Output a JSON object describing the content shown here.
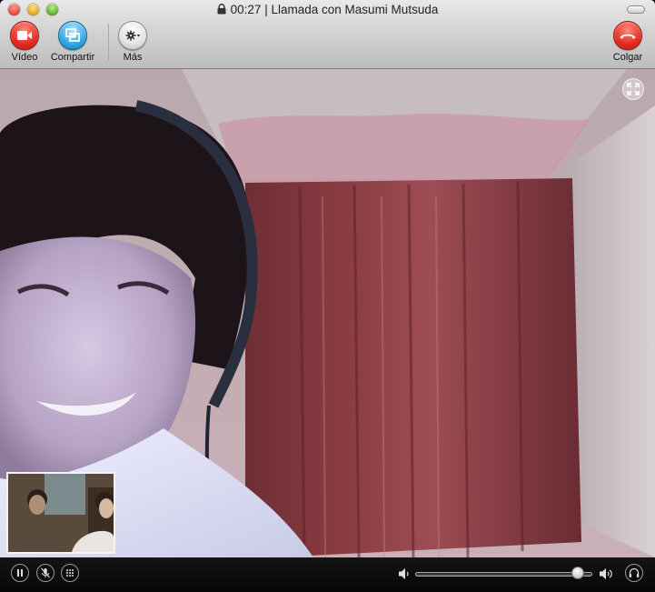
{
  "window": {
    "timer": "00:27",
    "separator": "|",
    "call_title": "Llamada con Masumi Mutsuda"
  },
  "toolbar": {
    "video_label": "Vídeo",
    "share_label": "Compartir",
    "more_label": "Más",
    "hangup_label": "Colgar"
  },
  "controls": {
    "volume_level": 0.92
  },
  "colors": {
    "hangup_red": "#e3261a",
    "share_blue": "#27a3e0"
  },
  "icons": {
    "video": "video-camera-icon",
    "share": "share-screen-icon",
    "more": "gear-icon",
    "hangup": "phone-hangup-icon",
    "pause": "pause-icon",
    "mute": "mic-mute-icon",
    "dialpad": "dialpad-icon",
    "volume_low": "volume-low-icon",
    "volume_high": "volume-high-icon",
    "audio": "headphones-icon",
    "fullscreen": "fullscreen-icon",
    "lock": "lock-icon"
  }
}
